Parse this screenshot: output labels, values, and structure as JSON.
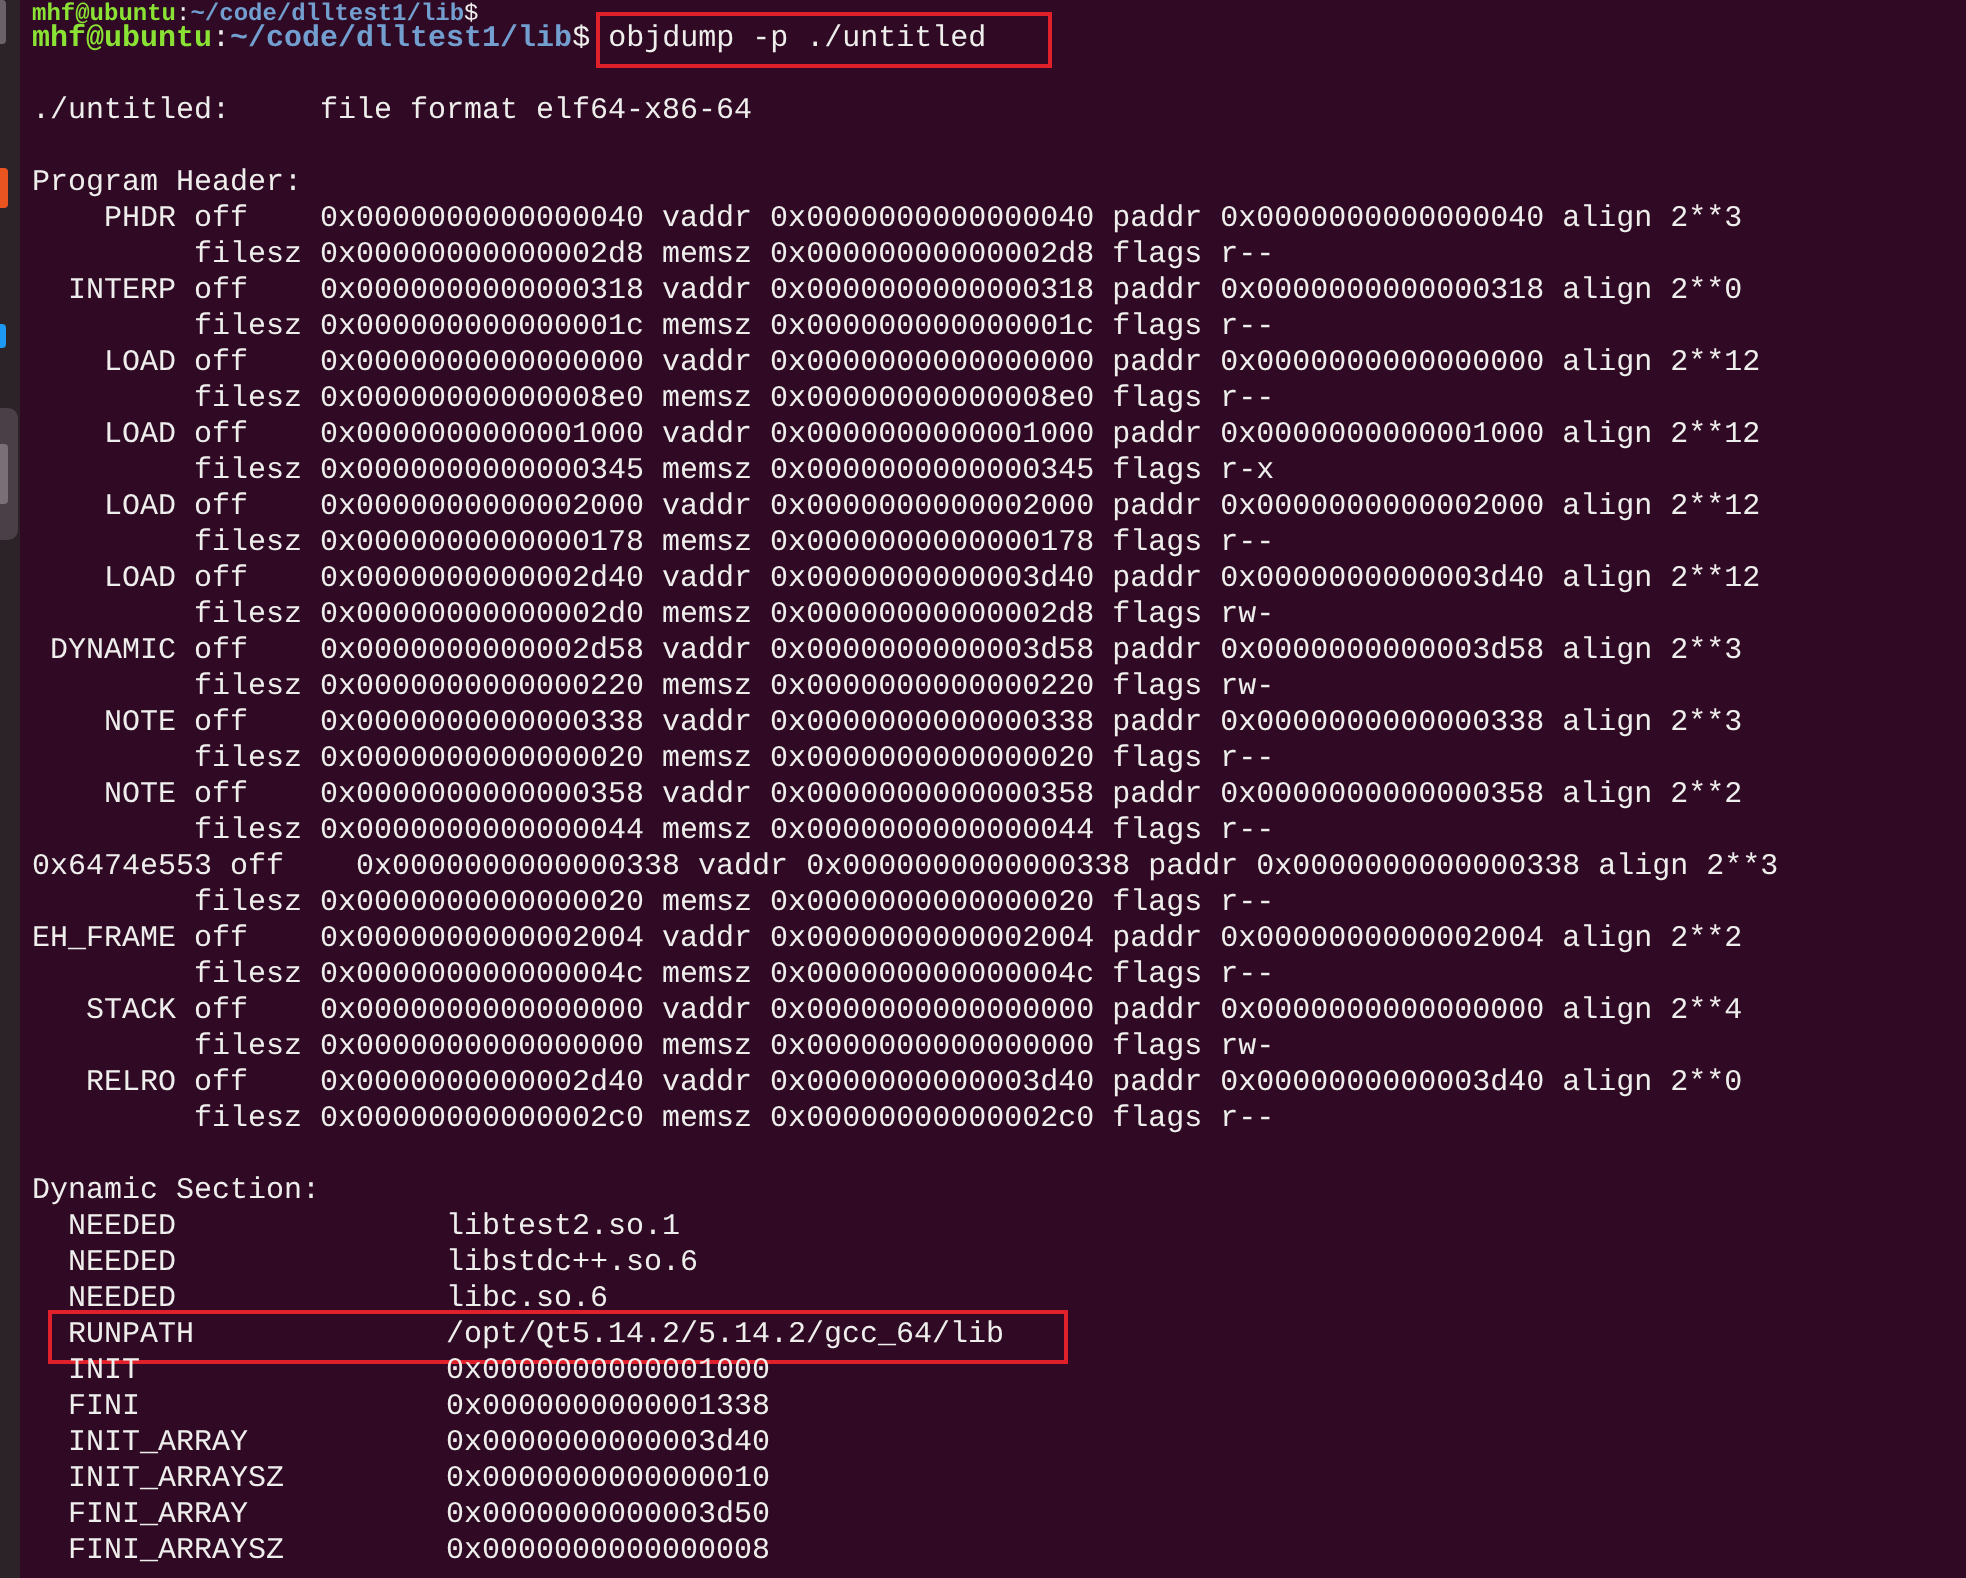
{
  "terminal": {
    "lines": [
      {
        "kind": "prompt",
        "user_host": "mhf@ubuntu",
        "separator": ":",
        "path": "~/code/dlltest1/lib",
        "symbol": "$",
        "highlighted": false
      },
      {
        "kind": "prompt",
        "user_host": "mhf@ubuntu",
        "separator": ":",
        "path": "~/code/dlltest1/lib",
        "symbol": "$",
        "command": "objdump -p ./untitled",
        "highlighted": true
      },
      {
        "kind": "blank"
      },
      {
        "kind": "text",
        "text": "./untitled:     file format elf64-x86-64"
      },
      {
        "kind": "blank"
      },
      {
        "kind": "text",
        "text": "Program Header:"
      },
      {
        "kind": "text",
        "text": "    PHDR off    0x0000000000000040 vaddr 0x0000000000000040 paddr 0x0000000000000040 align 2**3"
      },
      {
        "kind": "text",
        "text": "         filesz 0x00000000000002d8 memsz 0x00000000000002d8 flags r--"
      },
      {
        "kind": "text",
        "text": "  INTERP off    0x0000000000000318 vaddr 0x0000000000000318 paddr 0x0000000000000318 align 2**0"
      },
      {
        "kind": "text",
        "text": "         filesz 0x000000000000001c memsz 0x000000000000001c flags r--"
      },
      {
        "kind": "text",
        "text": "    LOAD off    0x0000000000000000 vaddr 0x0000000000000000 paddr 0x0000000000000000 align 2**12"
      },
      {
        "kind": "text",
        "text": "         filesz 0x00000000000008e0 memsz 0x00000000000008e0 flags r--"
      },
      {
        "kind": "text",
        "text": "    LOAD off    0x0000000000001000 vaddr 0x0000000000001000 paddr 0x0000000000001000 align 2**12"
      },
      {
        "kind": "text",
        "text": "         filesz 0x0000000000000345 memsz 0x0000000000000345 flags r-x"
      },
      {
        "kind": "text",
        "text": "    LOAD off    0x0000000000002000 vaddr 0x0000000000002000 paddr 0x0000000000002000 align 2**12"
      },
      {
        "kind": "text",
        "text": "         filesz 0x0000000000000178 memsz 0x0000000000000178 flags r--"
      },
      {
        "kind": "text",
        "text": "    LOAD off    0x0000000000002d40 vaddr 0x0000000000003d40 paddr 0x0000000000003d40 align 2**12"
      },
      {
        "kind": "text",
        "text": "         filesz 0x00000000000002d0 memsz 0x00000000000002d8 flags rw-"
      },
      {
        "kind": "text",
        "text": " DYNAMIC off    0x0000000000002d58 vaddr 0x0000000000003d58 paddr 0x0000000000003d58 align 2**3"
      },
      {
        "kind": "text",
        "text": "         filesz 0x0000000000000220 memsz 0x0000000000000220 flags rw-"
      },
      {
        "kind": "text",
        "text": "    NOTE off    0x0000000000000338 vaddr 0x0000000000000338 paddr 0x0000000000000338 align 2**3"
      },
      {
        "kind": "text",
        "text": "         filesz 0x0000000000000020 memsz 0x0000000000000020 flags r--"
      },
      {
        "kind": "text",
        "text": "    NOTE off    0x0000000000000358 vaddr 0x0000000000000358 paddr 0x0000000000000358 align 2**2"
      },
      {
        "kind": "text",
        "text": "         filesz 0x0000000000000044 memsz 0x0000000000000044 flags r--"
      },
      {
        "kind": "text",
        "text": "0x6474e553 off    0x0000000000000338 vaddr 0x0000000000000338 paddr 0x0000000000000338 align 2**3"
      },
      {
        "kind": "text",
        "text": "         filesz 0x0000000000000020 memsz 0x0000000000000020 flags r--"
      },
      {
        "kind": "text",
        "text": "EH_FRAME off    0x0000000000002004 vaddr 0x0000000000002004 paddr 0x0000000000002004 align 2**2"
      },
      {
        "kind": "text",
        "text": "         filesz 0x000000000000004c memsz 0x000000000000004c flags r--"
      },
      {
        "kind": "text",
        "text": "   STACK off    0x0000000000000000 vaddr 0x0000000000000000 paddr 0x0000000000000000 align 2**4"
      },
      {
        "kind": "text",
        "text": "         filesz 0x0000000000000000 memsz 0x0000000000000000 flags rw-"
      },
      {
        "kind": "text",
        "text": "   RELRO off    0x0000000000002d40 vaddr 0x0000000000003d40 paddr 0x0000000000003d40 align 2**0"
      },
      {
        "kind": "text",
        "text": "         filesz 0x00000000000002c0 memsz 0x00000000000002c0 flags r--"
      },
      {
        "kind": "blank"
      },
      {
        "kind": "text",
        "text": "Dynamic Section:"
      },
      {
        "kind": "entry",
        "tag": "NEEDED",
        "value": "libtest2.so.1",
        "highlighted": false
      },
      {
        "kind": "entry",
        "tag": "NEEDED",
        "value": "libstdc++.so.6",
        "highlighted": false
      },
      {
        "kind": "entry",
        "tag": "NEEDED",
        "value": "libc.so.6",
        "highlighted": false
      },
      {
        "kind": "entry",
        "tag": "RUNPATH",
        "value": "/opt/Qt5.14.2/5.14.2/gcc_64/lib",
        "highlighted": true
      },
      {
        "kind": "entry",
        "tag": "INIT",
        "value": "0x0000000000001000",
        "highlighted": false
      },
      {
        "kind": "entry",
        "tag": "FINI",
        "value": "0x0000000000001338",
        "highlighted": false
      },
      {
        "kind": "entry",
        "tag": "INIT_ARRAY",
        "value": "0x0000000000003d40",
        "highlighted": false
      },
      {
        "kind": "entry",
        "tag": "INIT_ARRAYSZ",
        "value": "0x0000000000000010",
        "highlighted": false
      },
      {
        "kind": "entry",
        "tag": "FINI_ARRAY",
        "value": "0x0000000000003d50",
        "highlighted": false
      },
      {
        "kind": "entry",
        "tag": "FINI_ARRAYSZ",
        "value": "0x0000000000000008",
        "highlighted": false
      }
    ]
  }
}
